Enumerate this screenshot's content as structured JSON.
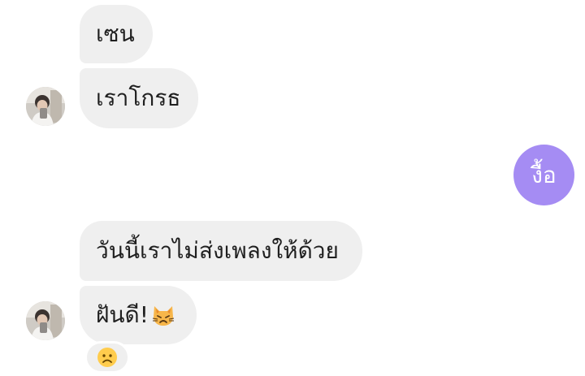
{
  "messages": {
    "m1": "เซน",
    "m2": "เราโกรธ",
    "m3": "งื้อ",
    "m4": "วันนี้เราไม่ส่งเพลงให้ด้วย",
    "m5": "ฝันดี!"
  },
  "icons": {
    "avatar": "contact-avatar",
    "cat_emoji": "weary-cat-emoji",
    "reaction": "frowning-face-emoji"
  },
  "colors": {
    "incoming_bubble": "#efefef",
    "outgoing_bubble": "#a58cf3",
    "outgoing_text": "#ffffff"
  }
}
